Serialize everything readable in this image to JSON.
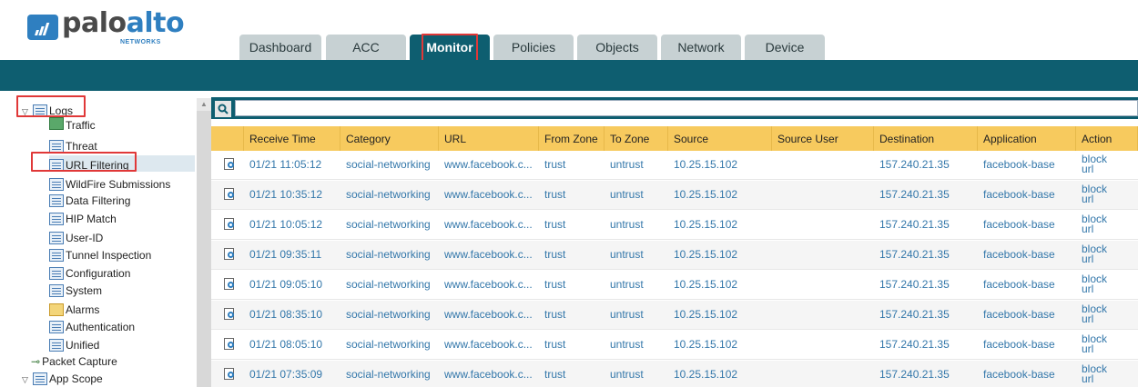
{
  "brand": {
    "name_a": "palo",
    "name_b": "alto",
    "sub": "NETWORKS",
    "primary_color": "#0e5e70",
    "accent_color": "#2f7fc0",
    "highlight_color": "#e03838"
  },
  "tabs": [
    {
      "label": "Dashboard"
    },
    {
      "label": "ACC"
    },
    {
      "label": "Monitor",
      "active": true
    },
    {
      "label": "Policies"
    },
    {
      "label": "Objects"
    },
    {
      "label": "Network"
    },
    {
      "label": "Device"
    }
  ],
  "sidebar": {
    "logs": {
      "label": "Logs",
      "icon": "logs-folder-icon",
      "expanded": true
    },
    "items": [
      {
        "label": "Traffic",
        "icon": "traffic-icon"
      },
      {
        "label": "Threat",
        "icon": "threat-icon"
      },
      {
        "label": "URL Filtering",
        "icon": "url-filtering-icon",
        "selected": true
      },
      {
        "label": "WildFire Submissions",
        "icon": "wildfire-icon"
      },
      {
        "label": "Data Filtering",
        "icon": "data-filtering-icon"
      },
      {
        "label": "HIP Match",
        "icon": "hip-match-icon"
      },
      {
        "label": "User-ID",
        "icon": "user-id-icon"
      },
      {
        "label": "Tunnel Inspection",
        "icon": "tunnel-inspection-icon"
      },
      {
        "label": "Configuration",
        "icon": "configuration-icon"
      },
      {
        "label": "System",
        "icon": "system-icon"
      },
      {
        "label": "Alarms",
        "icon": "alarms-icon"
      },
      {
        "label": "Authentication",
        "icon": "authentication-icon"
      },
      {
        "label": "Unified",
        "icon": "unified-icon"
      }
    ],
    "packet_capture": {
      "label": "Packet Capture",
      "icon": "packet-capture-icon"
    },
    "app_scope": {
      "label": "App Scope",
      "icon": "app-scope-icon",
      "expanded": true
    }
  },
  "search": {
    "icon": "search-icon",
    "value": ""
  },
  "table": {
    "columns": [
      "Receive Time",
      "Category",
      "URL",
      "From Zone",
      "To Zone",
      "Source",
      "Source User",
      "Destination",
      "Application",
      "Action"
    ],
    "rows": [
      {
        "time": "01/21 11:05:12",
        "category": "social-networking",
        "url": "www.facebook.c...",
        "from": "trust",
        "to": "untrust",
        "source": "10.25.15.102",
        "user": "",
        "dest": "157.240.21.35",
        "app": "facebook-base",
        "action": "block-url"
      },
      {
        "time": "01/21 10:35:12",
        "category": "social-networking",
        "url": "www.facebook.c...",
        "from": "trust",
        "to": "untrust",
        "source": "10.25.15.102",
        "user": "",
        "dest": "157.240.21.35",
        "app": "facebook-base",
        "action": "block-url"
      },
      {
        "time": "01/21 10:05:12",
        "category": "social-networking",
        "url": "www.facebook.c...",
        "from": "trust",
        "to": "untrust",
        "source": "10.25.15.102",
        "user": "",
        "dest": "157.240.21.35",
        "app": "facebook-base",
        "action": "block-url"
      },
      {
        "time": "01/21 09:35:11",
        "category": "social-networking",
        "url": "www.facebook.c...",
        "from": "trust",
        "to": "untrust",
        "source": "10.25.15.102",
        "user": "",
        "dest": "157.240.21.35",
        "app": "facebook-base",
        "action": "block-url"
      },
      {
        "time": "01/21 09:05:10",
        "category": "social-networking",
        "url": "www.facebook.c...",
        "from": "trust",
        "to": "untrust",
        "source": "10.25.15.102",
        "user": "",
        "dest": "157.240.21.35",
        "app": "facebook-base",
        "action": "block-url"
      },
      {
        "time": "01/21 08:35:10",
        "category": "social-networking",
        "url": "www.facebook.c...",
        "from": "trust",
        "to": "untrust",
        "source": "10.25.15.102",
        "user": "",
        "dest": "157.240.21.35",
        "app": "facebook-base",
        "action": "block-url"
      },
      {
        "time": "01/21 08:05:10",
        "category": "social-networking",
        "url": "www.facebook.c...",
        "from": "trust",
        "to": "untrust",
        "source": "10.25.15.102",
        "user": "",
        "dest": "157.240.21.35",
        "app": "facebook-base",
        "action": "block-url"
      },
      {
        "time": "01/21 07:35:09",
        "category": "social-networking",
        "url": "www.facebook.c...",
        "from": "trust",
        "to": "untrust",
        "source": "10.25.15.102",
        "user": "",
        "dest": "157.240.21.35",
        "app": "facebook-base",
        "action": "block-url"
      }
    ]
  }
}
